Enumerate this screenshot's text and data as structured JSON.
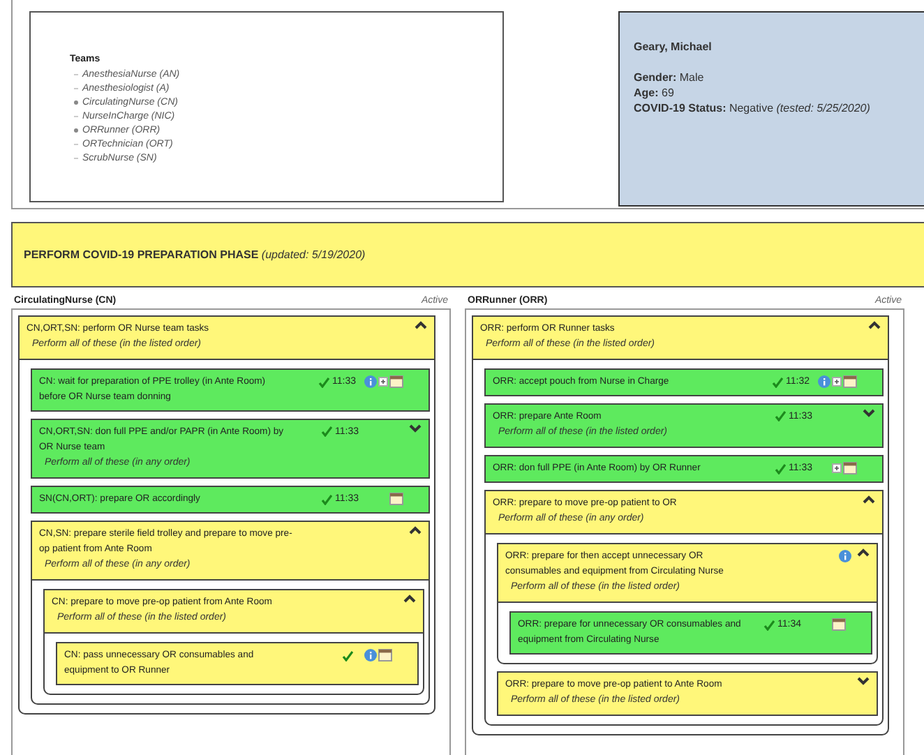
{
  "teams": {
    "title": "Teams",
    "items": [
      {
        "label": "AnesthesiaNurse (AN)",
        "selected": false
      },
      {
        "label": "Anesthesiologist (A)",
        "selected": false
      },
      {
        "label": "CirculatingNurse (CN)",
        "selected": true
      },
      {
        "label": "NurseInCharge (NIC)",
        "selected": false
      },
      {
        "label": "ORRunner (ORR)",
        "selected": true
      },
      {
        "label": "ORTechnician (ORT)",
        "selected": false
      },
      {
        "label": "ScrubNurse (SN)",
        "selected": false
      }
    ]
  },
  "patient": {
    "name": "Geary, Michael",
    "fields": [
      {
        "label": "Gender:",
        "value": "Male"
      },
      {
        "label": "Age:",
        "value": "69"
      },
      {
        "label": "COVID-19 Status:",
        "value": "Negative",
        "note": "(tested: 5/25/2020)"
      }
    ]
  },
  "phase": {
    "title": "PERFORM COVID-19 PREPARATION PHASE",
    "note": "(updated: 5/19/2020)"
  },
  "columns": [
    {
      "title": "CirculatingNurse (CN)",
      "status": "Active",
      "tasks": [
        {
          "label": "CN,ORT,SN: perform OR Nurse team tasks",
          "note": "Perform all of these (in the listed order)",
          "done": false,
          "expanded": true,
          "children": [
            {
              "label": "CN: wait for preparation of PPE trolley (in Ante Room) before OR Nurse team donning",
              "done": true,
              "checked": true,
              "time": "11:33",
              "info": true,
              "plus": true,
              "calendar": true
            },
            {
              "label": "CN,ORT,SN: don full PPE and/or PAPR (in Ante Room) by OR Nurse team",
              "note": "Perform all of these (in any order)",
              "done": true,
              "checked": true,
              "time": "11:33",
              "expanded": false
            },
            {
              "label": "SN(CN,ORT): prepare OR accordingly",
              "done": true,
              "checked": true,
              "time": "11:33",
              "calendar": true
            },
            {
              "label": "CN,SN: prepare sterile field trolley and prepare to move pre-op patient from Ante Room",
              "note": "Perform all of these (in any order)",
              "done": false,
              "expanded": true,
              "children": [
                {
                  "label": "CN: prepare to move pre-op patient from Ante Room",
                  "note": "Perform all of these (in the listed order)",
                  "done": false,
                  "expanded": true,
                  "children": [
                    {
                      "label": "CN: pass unnecessary OR consumables and equipment to OR Runner",
                      "done": false,
                      "checked": true,
                      "info": true,
                      "calendar": true
                    }
                  ]
                }
              ]
            }
          ]
        }
      ]
    },
    {
      "title": "ORRunner (ORR)",
      "status": "Active",
      "tasks": [
        {
          "label": "ORR: perform OR Runner tasks",
          "note": "Perform all of these (in the listed order)",
          "done": false,
          "expanded": true,
          "children": [
            {
              "label": "ORR: accept pouch from Nurse in Charge",
              "done": true,
              "checked": true,
              "time": "11:32",
              "info": true,
              "plus": true,
              "calendar": true
            },
            {
              "label": "ORR: prepare Ante Room",
              "note": "Perform all of these (in the listed order)",
              "done": true,
              "checked": true,
              "time": "11:33",
              "expanded": false
            },
            {
              "label": "ORR: don full PPE (in Ante Room) by OR Runner",
              "done": true,
              "checked": true,
              "time": "11:33",
              "plus": true,
              "calendar": true
            },
            {
              "label": "ORR: prepare to move pre-op patient to OR",
              "note": "Perform all of these (in any order)",
              "done": false,
              "expanded": true,
              "children": [
                {
                  "label": "ORR: prepare for then accept unnecessary OR consumables and equipment from Circulating Nurse",
                  "note": "Perform all of these (in the listed order)",
                  "done": false,
                  "expanded": true,
                  "info": true,
                  "children": [
                    {
                      "label": "ORR: prepare for unnecessary OR consumables and equipment from Circulating Nurse",
                      "done": true,
                      "checked": true,
                      "time": "11:34",
                      "calendar": true
                    }
                  ]
                },
                {
                  "label": "ORR: prepare to move pre-op patient to Ante Room",
                  "note": "Perform all of these (in the listed order)",
                  "done": false,
                  "expanded": false
                }
              ]
            }
          ]
        }
      ]
    }
  ]
}
